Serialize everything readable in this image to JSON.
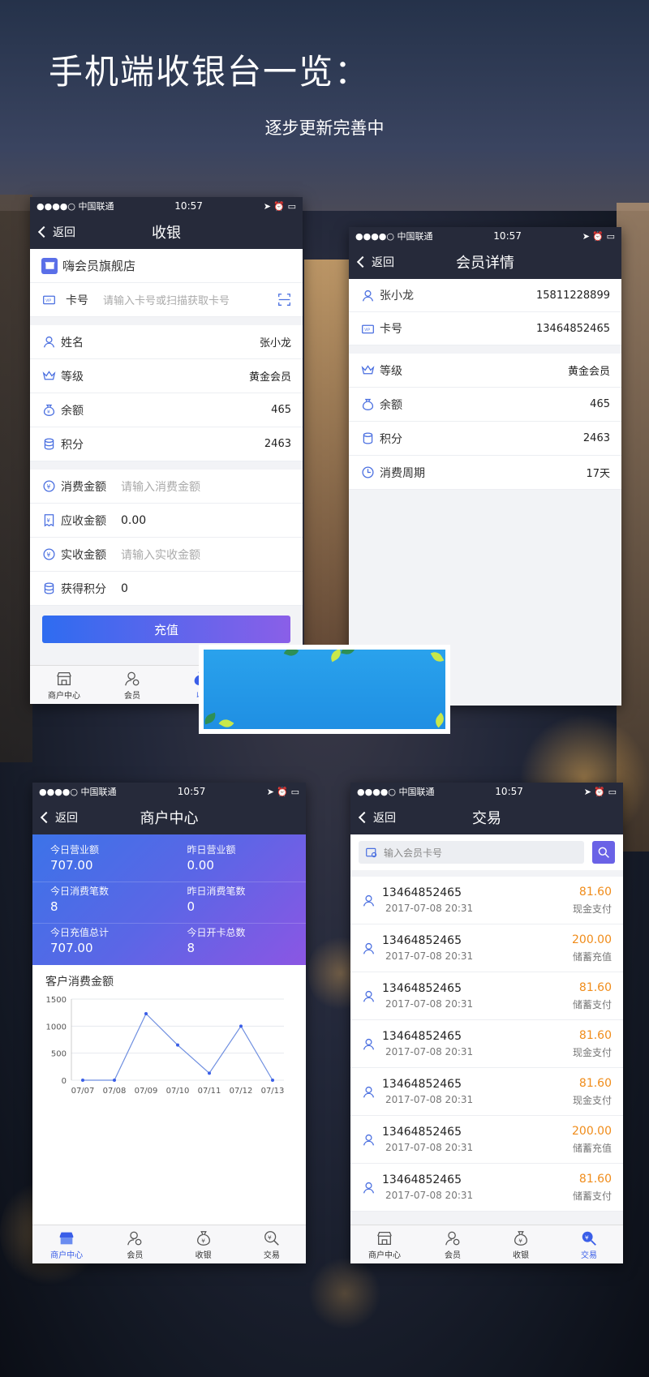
{
  "hero": {
    "title": "手机端收银台一览：",
    "subtitle": "逐步更新完善中"
  },
  "status": {
    "carrier": "●●●●○ 中国联通",
    "time": "10:57"
  },
  "common": {
    "back": "返回"
  },
  "cashier": {
    "title": "收银",
    "store": "嗨会员旗舰店",
    "card_label": "卡号",
    "card_placeholder": "请输入卡号或扫描获取卡号",
    "fields": [
      {
        "label": "姓名",
        "value": "张小龙"
      },
      {
        "label": "等级",
        "value": "黄金会员"
      },
      {
        "label": "余额",
        "value": "465"
      },
      {
        "label": "积分",
        "value": "2463"
      }
    ],
    "consume_label": "消费金额",
    "consume_placeholder": "请输入消费金额",
    "receivable_label": "应收金额",
    "receivable_value": "0.00",
    "actual_label": "实收金额",
    "actual_placeholder": "请输入实收金额",
    "points_label": "获得积分",
    "points_value": "0",
    "submit": "充值",
    "tabs": [
      "商户中心",
      "会员",
      "收"
    ]
  },
  "member": {
    "title": "会员详情",
    "name": "张小龙",
    "phone": "15811228899",
    "card_label": "卡号",
    "card": "13464852465",
    "fields": [
      {
        "label": "等级",
        "value": "黄金会员"
      },
      {
        "label": "余额",
        "value": "465"
      },
      {
        "label": "积分",
        "value": "2463"
      },
      {
        "label": "消费周期",
        "value": "17天"
      }
    ]
  },
  "merchant": {
    "title": "商户中心",
    "stats": [
      [
        {
          "k": "今日营业额",
          "v": "707.00"
        },
        {
          "k": "昨日营业额",
          "v": "0.00"
        }
      ],
      [
        {
          "k": "今日消费笔数",
          "v": "8"
        },
        {
          "k": "昨日消费笔数",
          "v": "0"
        }
      ],
      [
        {
          "k": "今日充值总计",
          "v": "707.00"
        },
        {
          "k": "今日开卡总数",
          "v": "8"
        }
      ]
    ],
    "tabs": [
      "商户中心",
      "会员",
      "收银",
      "交易"
    ]
  },
  "chart_data": {
    "type": "line",
    "title": "客户消费金额",
    "categories": [
      "07/07",
      "07/08",
      "07/09",
      "07/10",
      "07/11",
      "07/12",
      "07/13"
    ],
    "values": [
      0,
      0,
      1230,
      650,
      130,
      1000,
      0
    ],
    "yticks": [
      "1500",
      "1000",
      "500",
      "0"
    ],
    "ylim": [
      0,
      1500
    ],
    "color": "#6f8fe0"
  },
  "trade": {
    "title": "交易",
    "search_placeholder": "输入会员卡号",
    "items": [
      {
        "card": "13464852465",
        "time": "2017-07-08 20:31",
        "amount": "81.60",
        "method": "现金支付"
      },
      {
        "card": "13464852465",
        "time": "2017-07-08 20:31",
        "amount": "200.00",
        "method": "储蓄充值"
      },
      {
        "card": "13464852465",
        "time": "2017-07-08 20:31",
        "amount": "81.60",
        "method": "储蓄支付"
      },
      {
        "card": "13464852465",
        "time": "2017-07-08 20:31",
        "amount": "81.60",
        "method": "现金支付"
      },
      {
        "card": "13464852465",
        "time": "2017-07-08 20:31",
        "amount": "81.60",
        "method": "现金支付"
      },
      {
        "card": "13464852465",
        "time": "2017-07-08 20:31",
        "amount": "200.00",
        "method": "储蓄充值"
      },
      {
        "card": "13464852465",
        "time": "2017-07-08 20:31",
        "amount": "81.60",
        "method": "储蓄支付"
      }
    ],
    "tabs": [
      "商户中心",
      "会员",
      "收银",
      "交易"
    ]
  }
}
